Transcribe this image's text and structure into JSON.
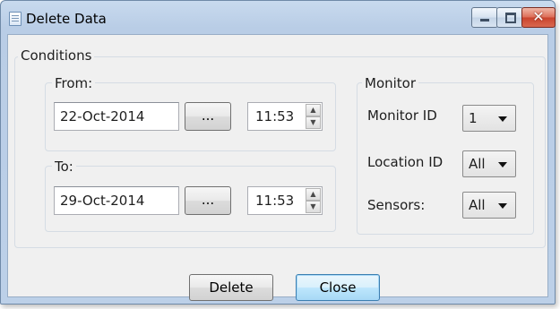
{
  "window": {
    "title": "Delete Data",
    "controls": {
      "minimize": "minimize-icon",
      "maximize": "maximize-icon",
      "close": "close-icon"
    }
  },
  "conditions": {
    "label": "Conditions",
    "from": {
      "label": "From:",
      "date": "22-Oct-2014",
      "browse_label": "...",
      "time": "11:53"
    },
    "to": {
      "label": "To:",
      "date": "29-Oct-2014",
      "browse_label": "...",
      "time": "11:53"
    }
  },
  "monitor": {
    "label": "Monitor",
    "monitor_id": {
      "label": "Monitor ID",
      "value": "1"
    },
    "location_id": {
      "label": "Location ID",
      "value": "All"
    },
    "sensors": {
      "label": "Sensors:",
      "value": "All"
    }
  },
  "actions": {
    "delete_label": "Delete",
    "close_label": "Close"
  },
  "colors": {
    "title_bar": "#c8daee",
    "close_button": "#c9432c",
    "focus_border": "#3c7fb1"
  }
}
